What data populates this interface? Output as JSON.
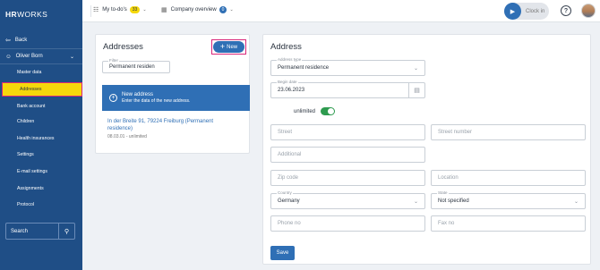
{
  "app": {
    "logo_bold": "HR",
    "logo_rest": "WORKS"
  },
  "sidebar": {
    "back_label": "Back",
    "user_name": "Oliver Born",
    "items": [
      {
        "label": "Master data"
      },
      {
        "label": "Addresses"
      },
      {
        "label": "Bank account"
      },
      {
        "label": "Children"
      },
      {
        "label": "Health insurances"
      },
      {
        "label": "Settings"
      },
      {
        "label": "E-mail settings"
      },
      {
        "label": "Assignments"
      },
      {
        "label": "Protocol"
      }
    ],
    "search_label": "Search"
  },
  "topbar": {
    "todos_label": "My to-do's",
    "todos_count": "33",
    "company_label": "Company overview",
    "company_count": "0",
    "clock_in_label": "Clock in",
    "help_label": "?"
  },
  "addresses": {
    "title": "Addresses",
    "new_button": "New",
    "filter_label": "Filter",
    "filter_value": "Permanent residen",
    "new_card_title": "New address",
    "new_card_subtitle": "Enter the data of the new address.",
    "entry_address": "In der Breite 91, 79224 Freiburg (Permanent residence)",
    "entry_meta": "08.03.01 - unlimited"
  },
  "form": {
    "title": "Address",
    "address_type_label": "Address type",
    "address_type_value": "Permanent residence",
    "begin_date_label": "Begin date",
    "begin_date_value": "23.06.2023",
    "unlimited_label": "unlimited",
    "unlimited_on": true,
    "street_placeholder": "Street",
    "street_number_placeholder": "Street number",
    "additional_placeholder": "Additional",
    "zip_placeholder": "Zip code",
    "location_placeholder": "Location",
    "country_label": "Country",
    "country_value": "Germany",
    "state_label": "State",
    "state_value": "Not specified",
    "phone_placeholder": "Phone no",
    "fax_placeholder": "Fax no",
    "save_label": "Save"
  },
  "colors": {
    "sidebar_bg": "#1f4e86",
    "accent": "#2f6fb5",
    "highlight": "#f5d80b",
    "annotation": "#d9267a",
    "toggle_on": "#2e9b4f"
  }
}
